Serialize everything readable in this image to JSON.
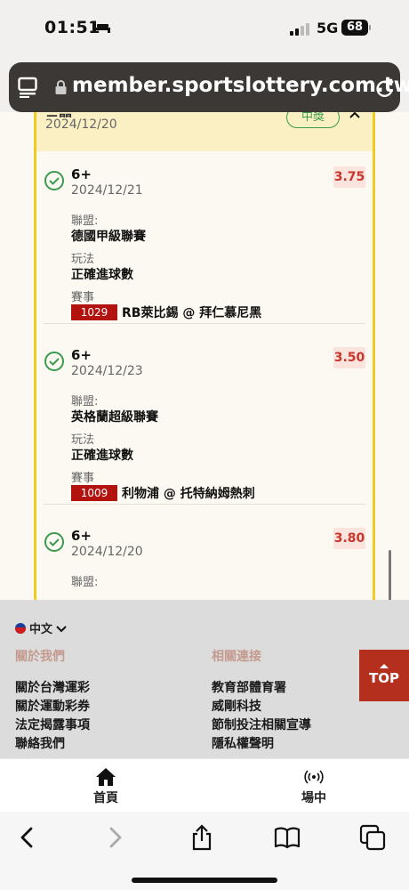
{
  "status": {
    "time": "01:51",
    "network": "5G",
    "battery": "68"
  },
  "browser": {
    "url": "member.sportslottery.com.tw"
  },
  "ticket": {
    "header_title": "二關",
    "header_date": "2024/12/20",
    "status_badge": "中獎",
    "bets": [
      {
        "pick": "6+",
        "date": "2024/12/21",
        "odds": "3.75",
        "league_label": "聯盟:",
        "league": "德國甲級聯賽",
        "market_label": "玩法",
        "market": "正確進球數",
        "event_label": "賽事",
        "match_no": "1029",
        "match": "RB萊比錫 @ 拜仁慕尼黑"
      },
      {
        "pick": "6+",
        "date": "2024/12/23",
        "odds": "3.50",
        "league_label": "聯盟:",
        "league": "英格蘭超級聯賽",
        "market_label": "玩法",
        "market": "正確進球數",
        "event_label": "賽事",
        "match_no": "1009",
        "match": "利物浦 @ 托特納姆熱刺"
      },
      {
        "pick": "6+",
        "date": "2024/12/20",
        "odds": "3.80",
        "league_label": "聯盟:"
      }
    ]
  },
  "footer": {
    "language": "中文",
    "about_title": "關於我們",
    "about_links": [
      "關於台灣運彩",
      "關於運動彩券",
      "法定揭露事項",
      "聯絡我們"
    ],
    "related_title": "相關連接",
    "related_links": [
      "教育部體育署",
      "威剛科技",
      "節制投注相關宣導",
      "隱私權聲明"
    ],
    "top_button": "TOP"
  },
  "tabs": {
    "home": "首頁",
    "live": "場中"
  },
  "colors": {
    "accent_red": "#b3130f",
    "win_green": "#3c9a4f",
    "card_border": "#f1cb1f"
  }
}
